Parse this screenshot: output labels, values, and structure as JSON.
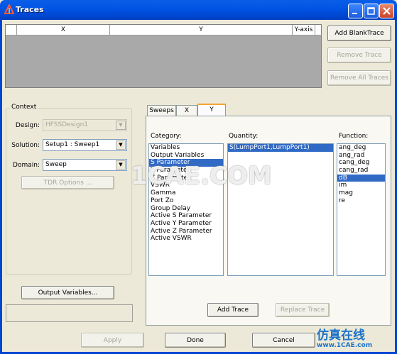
{
  "window": {
    "title": "Traces",
    "colors": {
      "titlebar": "#0055e5",
      "selection": "#316ac5",
      "face": "#ece9d8"
    }
  },
  "trace_table": {
    "columns": [
      "X",
      "Y",
      "Y-axis"
    ]
  },
  "top_buttons": {
    "add_blank": "Add BlankTrace",
    "remove": "Remove Trace",
    "remove_all": "Remove All Traces"
  },
  "context": {
    "label": "Context",
    "design_label": "Design:",
    "design_value": "HFSSDesign1",
    "solution_label": "Solution:",
    "solution_value": "Setup1 : Sweep1",
    "domain_label": "Domain:",
    "domain_value": "Sweep",
    "tdr_button": "TDR Options ..."
  },
  "output_variables_button": "Output Variables...",
  "tabs": [
    "Sweeps",
    "X",
    "Y"
  ],
  "category": {
    "label": "Category:",
    "items": [
      "Variables",
      "Output Variables",
      "S Parameter",
      "Y Parameter",
      "Z Parameter",
      "VSWR",
      "Gamma",
      "Port Zo",
      "Group Delay",
      "Active S Parameter",
      "Active Y Parameter",
      "Active Z Parameter",
      "Active VSWR"
    ],
    "selected": "S Parameter"
  },
  "quantity": {
    "label": "Quantity:",
    "items": [
      "S(LumpPort1,LumpPort1)"
    ],
    "selected": "S(LumpPort1,LumpPort1)"
  },
  "function": {
    "label": "Function:",
    "items": [
      "ang_deg",
      "ang_rad",
      "cang_deg",
      "cang_rad",
      "dB",
      "im",
      "mag",
      "re"
    ],
    "selected": "dB"
  },
  "trace_buttons": {
    "add": "Add Trace",
    "replace": "Replace Trace"
  },
  "bottom_buttons": {
    "apply": "Apply",
    "done": "Done",
    "cancel": "Cancel"
  },
  "watermark": {
    "text": "1CAE.COM",
    "brand_cn": "仿真在线",
    "brand_url": "www.1CAE.com"
  }
}
